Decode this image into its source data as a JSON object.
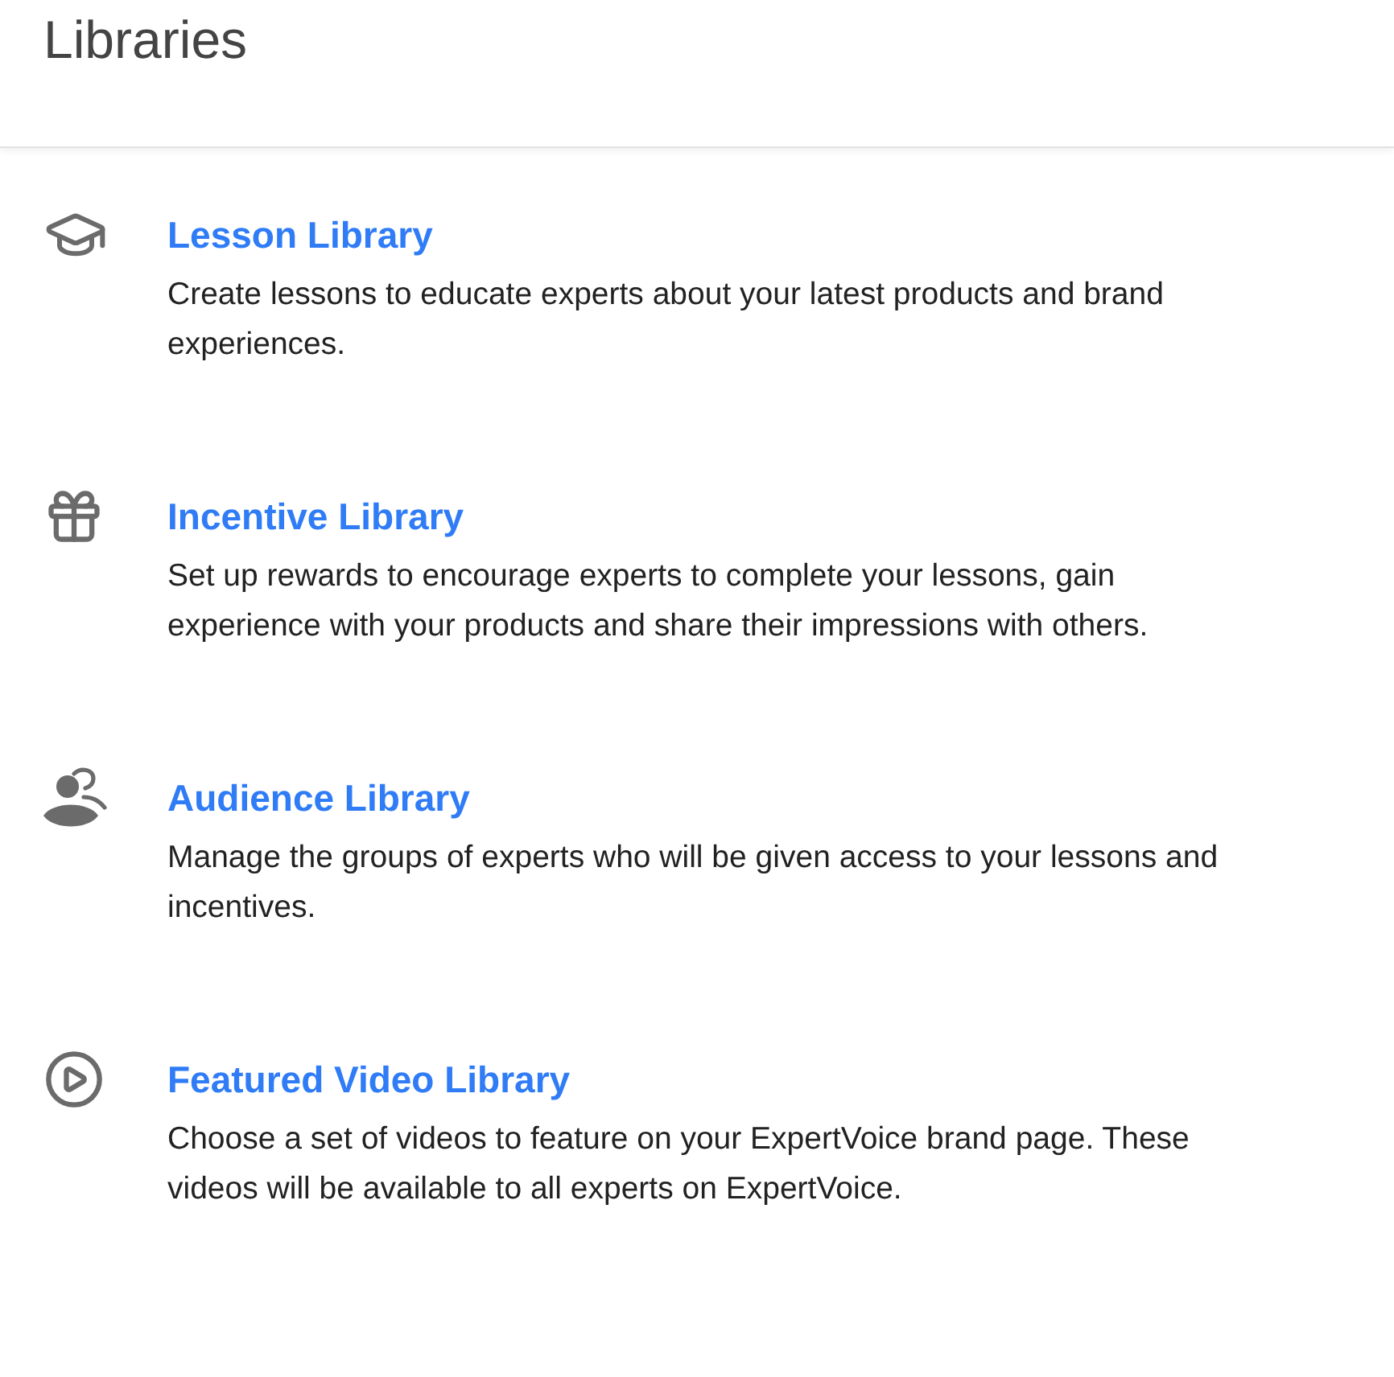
{
  "header": {
    "title": "Libraries"
  },
  "libraries": [
    {
      "kind": "lesson",
      "title": "Lesson Library",
      "description": "Create lessons to educate experts about your latest products and brand experiences."
    },
    {
      "kind": "incentive",
      "title": "Incentive Library",
      "description": "Set up rewards to encourage experts to complete your lessons, gain experience with your products and share their impressions with others."
    },
    {
      "kind": "audience",
      "title": "Audience Library",
      "description": "Manage the groups of experts who will be given access to your lessons and incentives."
    },
    {
      "kind": "video",
      "title": "Featured Video Library",
      "description": "Choose a set of videos to feature on your ExpertVoice brand page. These videos will be available to all experts on ExpertVoice."
    }
  ]
}
